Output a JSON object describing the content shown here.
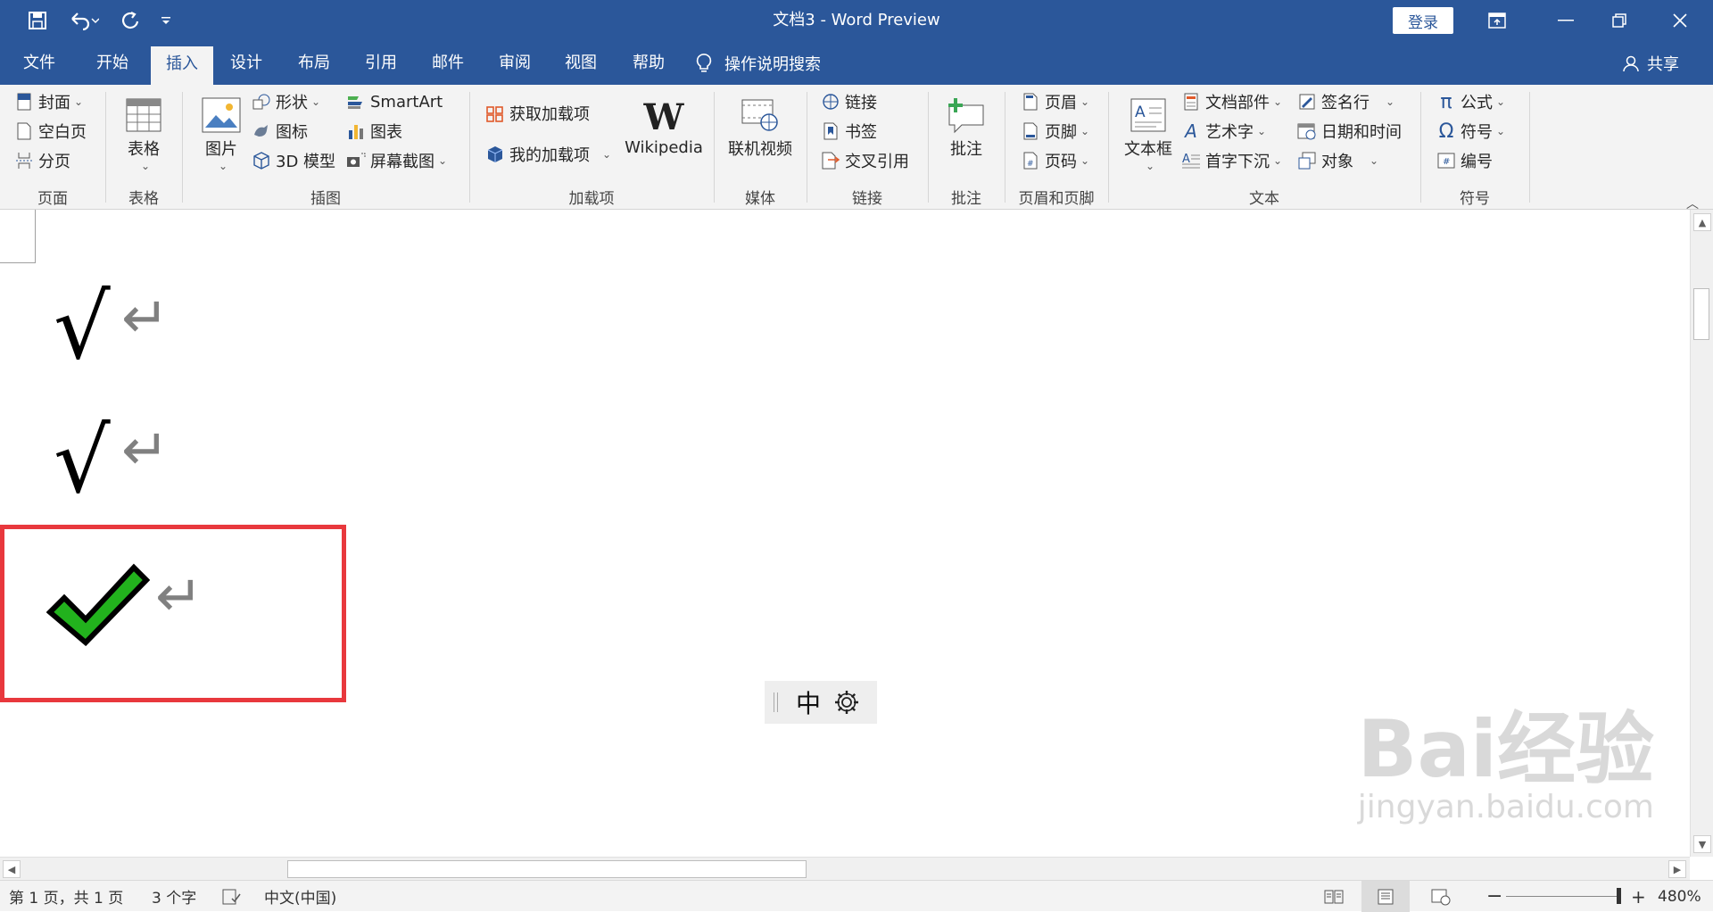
{
  "window": {
    "doc_name": "文档3",
    "separator": "-",
    "app_name": "Word Preview",
    "login_label": "登录"
  },
  "tabs": [
    {
      "label": "文件"
    },
    {
      "label": "开始"
    },
    {
      "label": "插入",
      "active": true
    },
    {
      "label": "设计"
    },
    {
      "label": "布局"
    },
    {
      "label": "引用"
    },
    {
      "label": "邮件"
    },
    {
      "label": "审阅"
    },
    {
      "label": "视图"
    },
    {
      "label": "帮助"
    }
  ],
  "tellme_label": "操作说明搜索",
  "share_label": "共享",
  "ribbon": {
    "pages": {
      "cover": "封面",
      "blank": "空白页",
      "break": "分页",
      "group": "页面"
    },
    "tables": {
      "table": "表格",
      "group": "表格"
    },
    "illustrations": {
      "pictures": "图片",
      "shapes": "形状",
      "icons": "图标",
      "model3d": "3D 模型",
      "smartart": "SmartArt",
      "chart": "图表",
      "screenshot": "屏幕截图",
      "group": "插图"
    },
    "addins": {
      "get": "获取加载项",
      "my": "我的加载项",
      "wikipedia": "Wikipedia",
      "group": "加载项"
    },
    "media": {
      "video": "联机视频",
      "group": "媒体"
    },
    "links": {
      "link": "链接",
      "bookmark": "书签",
      "crossref": "交叉引用",
      "group": "链接"
    },
    "comments": {
      "comment": "批注",
      "group": "批注"
    },
    "headerfooter": {
      "header": "页眉",
      "footer": "页脚",
      "pagenum": "页码",
      "group": "页眉和页脚"
    },
    "text": {
      "textbox": "文本框",
      "parts": "文档部件",
      "wordart": "艺术字",
      "dropcap": "首字下沉",
      "signature": "签名行",
      "datetime": "日期和时间",
      "object": "对象",
      "group": "文本"
    },
    "symbols": {
      "equation": "公式",
      "symbol": "符号",
      "number": "编号",
      "group": "符号"
    }
  },
  "document": {
    "line1": "√",
    "line2": "√",
    "pilcrow": "↵",
    "ime_mode": "中",
    "watermark_brand": "Bai经验",
    "watermark_url": "jingyan.baidu.com"
  },
  "status": {
    "page": "第 1 页，共 1 页",
    "words": "3 个字",
    "language": "中文(中国)",
    "zoom": "480%"
  },
  "colors": {
    "titlebar": "#2b579a",
    "ribbon_bg": "#f3f3f3",
    "highlight_box": "#e8383d",
    "check_green": "#22b21d"
  }
}
